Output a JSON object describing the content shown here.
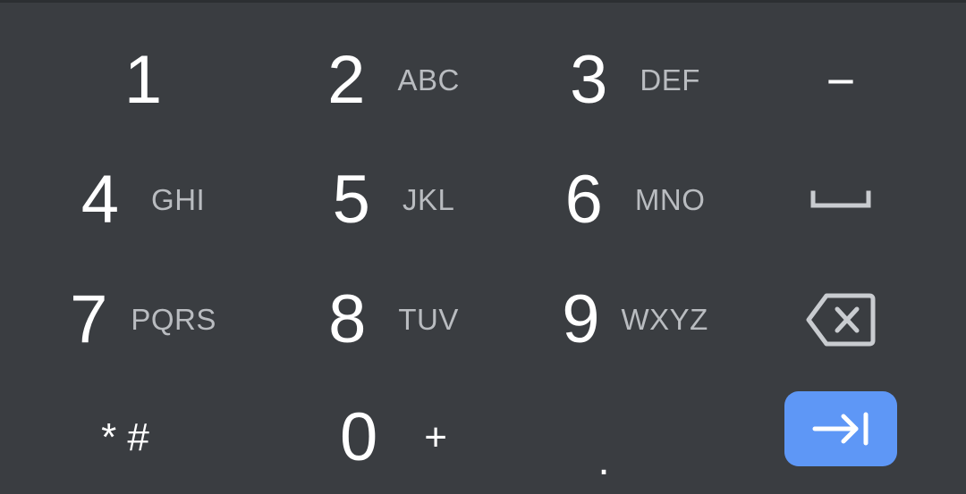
{
  "keypad": {
    "rows": [
      [
        {
          "digit": "1",
          "letters": ""
        },
        {
          "digit": "2",
          "letters": "ABC"
        },
        {
          "digit": "3",
          "letters": "DEF"
        }
      ],
      [
        {
          "digit": "4",
          "letters": "GHI"
        },
        {
          "digit": "5",
          "letters": "JKL"
        },
        {
          "digit": "6",
          "letters": "MNO"
        }
      ],
      [
        {
          "digit": "7",
          "letters": "PQRS"
        },
        {
          "digit": "8",
          "letters": "TUV"
        },
        {
          "digit": "9",
          "letters": "WXYZ"
        }
      ]
    ],
    "bottom": {
      "symbols_label": "* #",
      "zero_digit": "0",
      "zero_secondary": "+",
      "period_label": "."
    },
    "side_keys": {
      "minus_label": "−",
      "space_icon": "space-bar-icon",
      "backspace_icon": "backspace-icon",
      "enter_icon": "tab-next-icon"
    }
  },
  "colors": {
    "background": "#3a3d41",
    "digit": "#ffffff",
    "letters": "#b9bcc0",
    "accent": "#5e97f6"
  }
}
